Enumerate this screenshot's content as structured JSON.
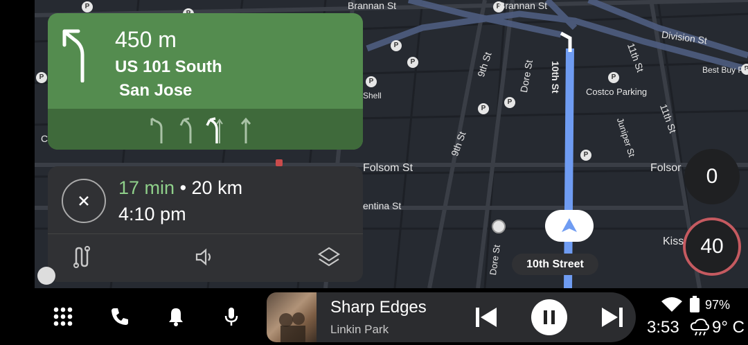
{
  "navigation": {
    "distance": "450 m",
    "road": "US 101 South",
    "destination": "San Jose"
  },
  "trip": {
    "duration": "17 min",
    "separator": "•",
    "distance": "20 km",
    "arrival": "4:10 pm"
  },
  "map": {
    "labels": {
      "brannan_st_1": "Brannan St",
      "brannan_st_2": "Brannan St",
      "division_st": "Division St",
      "11th_st_top": "11th St",
      "best_buy": "Best Buy Pa",
      "9th_st_top": "9th St",
      "dore_st_top": "Dore St",
      "10th_st": "10th St",
      "costco": "Costco Parking",
      "11th_st_mid": "11th St",
      "9th_st_mid": "9th St",
      "juniper_st": "Juniper St",
      "folsom_st": "Folsom St",
      "folsom_right": "Folsor",
      "entina_st": "entina St",
      "shell": "Shell",
      "dore_st_bottom": "Dore St",
      "kiss": "Kiss",
      "left_c": "C"
    },
    "current_street": "10th Street",
    "current_speed": "0",
    "speed_limit": "40",
    "route_color": "#6f9cf2"
  },
  "media": {
    "title": "Sharp Edges",
    "artist": "Linkin Park"
  },
  "status": {
    "battery": "97%",
    "time": "3:53",
    "temperature": "9° C"
  },
  "colors": {
    "nav_green": "#548c4f",
    "nav_lanes": "#3f6a3b",
    "card_bg": "#303134",
    "speed_limit_ring": "#c55a60"
  }
}
